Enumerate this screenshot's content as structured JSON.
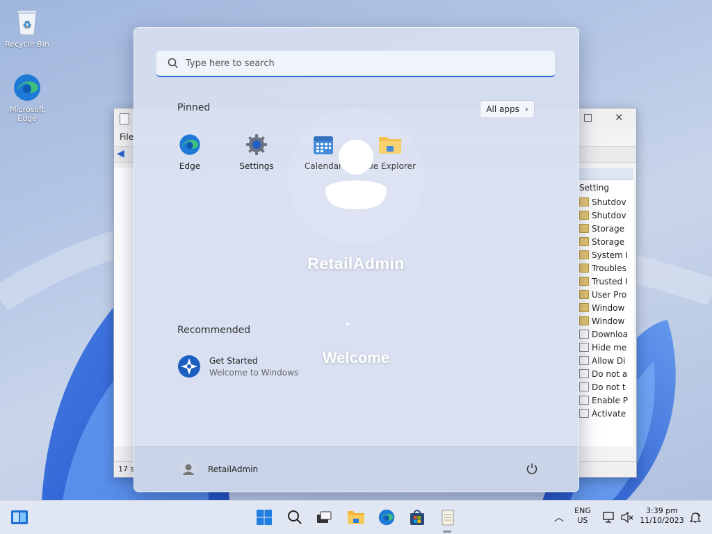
{
  "desktop": {
    "icons": [
      {
        "label": "Recycle Bin",
        "icon": "recycle-bin-icon"
      },
      {
        "label": "Microsoft Edge",
        "icon": "edge-icon"
      }
    ]
  },
  "background_window": {
    "menu_first": "File",
    "column_header": "Setting",
    "rows": [
      {
        "label": "Shutdov",
        "type": "folder"
      },
      {
        "label": "Shutdov",
        "type": "folder"
      },
      {
        "label": "Storage",
        "type": "folder"
      },
      {
        "label": "Storage",
        "type": "folder"
      },
      {
        "label": "System I",
        "type": "folder"
      },
      {
        "label": "Troubles",
        "type": "folder"
      },
      {
        "label": "Trusted I",
        "type": "folder"
      },
      {
        "label": "User Pro",
        "type": "folder"
      },
      {
        "label": "Window",
        "type": "folder"
      },
      {
        "label": "Window",
        "type": "folder"
      },
      {
        "label": "Downloa",
        "type": "doc"
      },
      {
        "label": "Hide me",
        "type": "doc"
      },
      {
        "label": "Allow Di",
        "type": "doc"
      },
      {
        "label": "Do not a",
        "type": "doc"
      },
      {
        "label": "Do not t",
        "type": "doc"
      },
      {
        "label": "Enable P",
        "type": "doc"
      },
      {
        "label": "Activate",
        "type": "doc"
      }
    ],
    "status": "17 se"
  },
  "start_menu": {
    "search_placeholder": "Type here to search",
    "pinned_title": "Pinned",
    "all_apps_label": "All apps",
    "pinned": [
      {
        "label": "Edge",
        "icon": "edge-icon"
      },
      {
        "label": "Settings",
        "icon": "gear-icon"
      },
      {
        "label": "Calendar",
        "icon": "calendar-icon"
      },
      {
        "label": "File Explorer",
        "icon": "folder-icon"
      }
    ],
    "recommended_title": "Recommended",
    "recommended": [
      {
        "title": "Get Started",
        "subtitle": "Welcome to Windows",
        "icon": "get-started-icon"
      }
    ],
    "user_name": "RetailAdmin"
  },
  "welcome_overlay": {
    "user_name": "RetailAdmin",
    "message": "Welcome"
  },
  "taskbar": {
    "language": "ENG",
    "region": "US",
    "time": "3:39 pm",
    "date": "11/10/2023"
  },
  "colors": {
    "accent": "#2a64c8",
    "edge_blue": "#1e7ad6",
    "edge_green": "#3ec27a",
    "folder_yellow": "#f2b73a"
  }
}
